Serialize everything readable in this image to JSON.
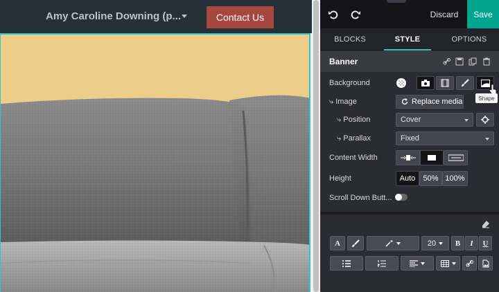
{
  "site": {
    "user_name": "Amy Caroline Downing (p...",
    "contact_label": "Contact Us"
  },
  "editor": {
    "discard_label": "Discard",
    "save_label": "Save",
    "tabs": [
      "BLOCKS",
      "STYLE",
      "OPTIONS"
    ],
    "active_tab": "STYLE",
    "section_title": "Banner",
    "rows": {
      "background": "Background",
      "image": "Image",
      "position": "Position",
      "position_value": "Cover",
      "parallax": "Parallax",
      "parallax_value": "Fixed",
      "content_width": "Content Width",
      "height": "Height",
      "scroll_down": "Scroll Down Butt..."
    },
    "image_prefix": "⤷",
    "replace_media_label": "Replace media",
    "height_options": [
      "Auto",
      "50%",
      "100%"
    ],
    "height_selected": "Auto",
    "tooltip": "Shape",
    "font_size": "20",
    "format_labels": {
      "bold": "B",
      "italic": "I",
      "underline": "U",
      "letter": "A"
    }
  },
  "colors": {
    "accent": "#01a48f",
    "contact_bg": "#a5473f",
    "selection": "#35c3c8",
    "banner_sky": "#edcd8a"
  }
}
